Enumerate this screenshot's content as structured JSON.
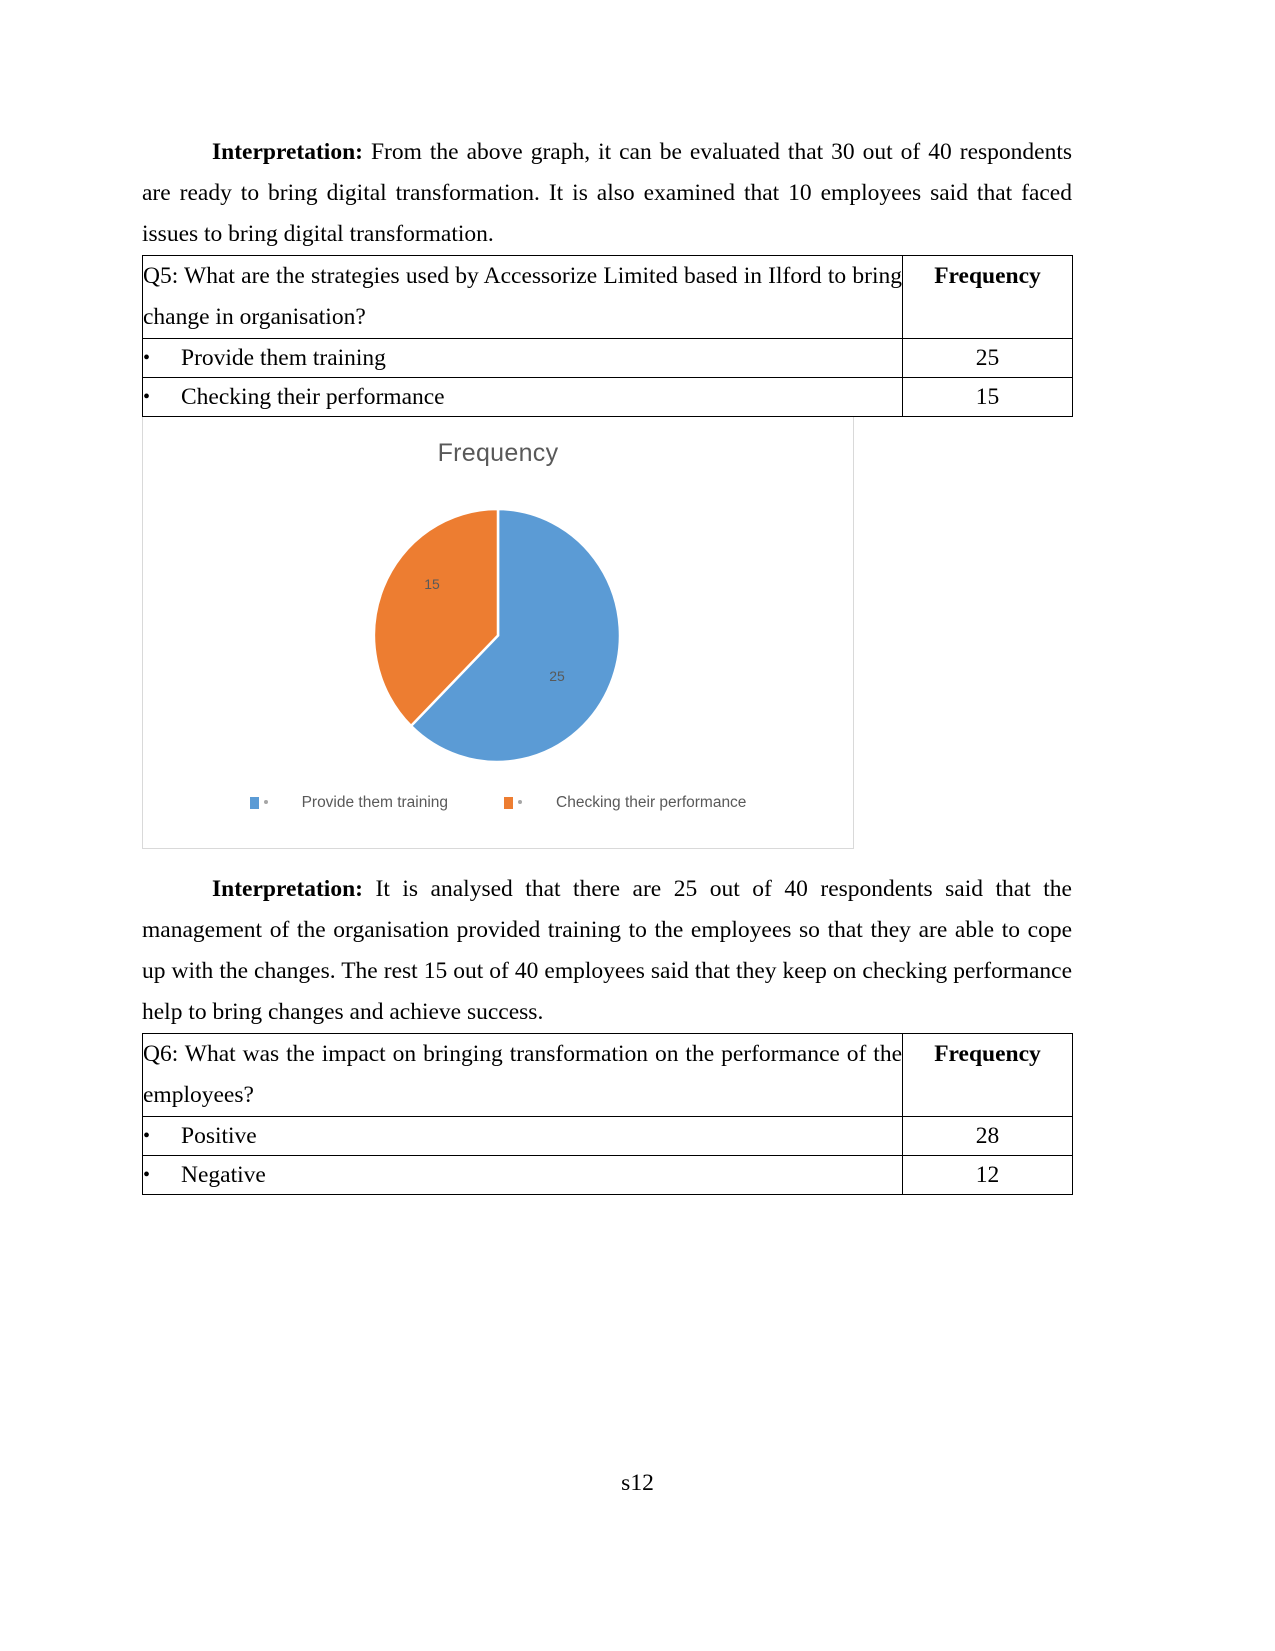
{
  "document": {
    "footer_page_label": "s12"
  },
  "interpretation_1": {
    "label": "Interpretation:",
    "body": " From the above graph, it can be evaluated that 30 out of 40 respondents are ready to bring digital transformation. It is also examined that 10 employees said that faced issues to bring digital transformation."
  },
  "table_q5": {
    "question": "Q5: What are the strategies used by Accessorize Limited based in Ilford to bring change in organisation?",
    "frequency_header": "Frequency",
    "bullet_glyph": "•",
    "rows": [
      {
        "option": "Provide them training",
        "value": "25"
      },
      {
        "option": "Checking their performance",
        "value": "15"
      }
    ]
  },
  "chart_data": {
    "type": "pie",
    "title": "Frequency",
    "categories": [
      "Provide them training",
      "Checking their performance"
    ],
    "values": [
      25,
      15
    ],
    "labels": [
      "25",
      "15"
    ],
    "colors": [
      "#5B9BD5",
      "#ED7D31"
    ],
    "total": 40,
    "legend_position": "bottom",
    "legend": [
      {
        "label": "Provide them training",
        "color": "#5B9BD5"
      },
      {
        "label": "Checking their performance",
        "color": "#ED7D31"
      }
    ],
    "xlabel": "",
    "ylabel": "",
    "grid": false
  },
  "interpretation_2": {
    "label": "Interpretation:",
    "body": " It is analysed that there are 25 out of 40 respondents said that the management of the organisation provided training to the employees so that they are able to cope up with the changes. The rest 15 out of 40 employees  said that they keep on checking performance help to bring changes and achieve success."
  },
  "table_q6": {
    "question": "Q6: What was the impact on bringing transformation on the performance of the employees?",
    "frequency_header": "Frequency",
    "bullet_glyph": "•",
    "rows": [
      {
        "option": "Positive",
        "value": "28"
      },
      {
        "option": "Negative",
        "value": "12"
      }
    ]
  }
}
